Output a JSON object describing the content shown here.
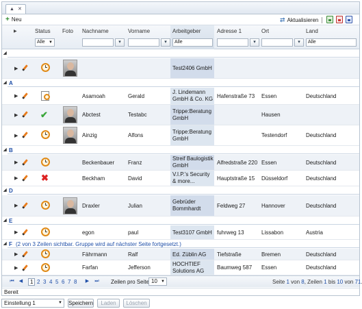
{
  "toolbar": {
    "new_label": "Neu",
    "refresh_label": "Aktualisieren"
  },
  "columns": {
    "status": "Status",
    "photo": "Foto",
    "lastname": "Nachname",
    "firstname": "Vorname",
    "employer": "Arbeitgeber",
    "address": "Adresse 1",
    "city": "Ort",
    "country": "Land"
  },
  "filters": {
    "status": "Alle",
    "employer": "Alle",
    "country": "Alle"
  },
  "groups": {
    "blank": "",
    "A": "A",
    "B": "B",
    "D": "D",
    "E": "E",
    "F": "F",
    "F_note": "(2 von 3 Zeilen sichtbar. Gruppe wird auf nächster Seite fortgesetzt.)"
  },
  "rows": [
    {
      "status": "clock",
      "lastname": "",
      "firstname": "",
      "employer": "Test2406 GmbH",
      "address": "",
      "city": "",
      "country": ""
    },
    {
      "status": "doc-clock",
      "lastname": "Asamoah",
      "firstname": "Gerald",
      "employer": "J. Lindemann GmbH & Co. KG",
      "address": "Hafenstraße 73",
      "city": "Essen",
      "country": "Deutschland"
    },
    {
      "status": "check",
      "lastname": "Abctest",
      "firstname": "Testabc",
      "employer": "Trippe:Beratung GmbH",
      "address": "",
      "city": "Hausen",
      "country": ""
    },
    {
      "status": "clock",
      "lastname": "Ainzig",
      "firstname": "Alfons",
      "employer": "Trippe:Beratung GmbH",
      "address": "",
      "city": "Testendorf",
      "country": "Deutschland"
    },
    {
      "status": "clock",
      "lastname": "Beckenbauer",
      "firstname": "Franz",
      "employer": "Streif Baulogistik GmbH",
      "address": "Alfredstraße 220",
      "city": "Essen",
      "country": "Deutschland"
    },
    {
      "status": "cross",
      "lastname": "Beckham",
      "firstname": "David",
      "employer": "V.I.P.'s Security & more...",
      "address": "Hauptstraße 15",
      "city": "Düsseldorf",
      "country": "Deutschland"
    },
    {
      "status": "clock",
      "lastname": "Draxler",
      "firstname": "Julian",
      "employer": "Gebrüder Bommhardt",
      "address": "Feldweg 27",
      "city": "Hannover",
      "country": "Deutschland"
    },
    {
      "status": "clock",
      "lastname": "egon",
      "firstname": "paul",
      "employer": "Test3107 GmbH",
      "address": "fuhrweg 13",
      "city": "Lissabon",
      "country": "Austria"
    },
    {
      "status": "clock",
      "lastname": "Fährmann",
      "firstname": "Ralf",
      "employer": "Ed. Züblin AG",
      "address": "Tiefstraße",
      "city": "Bremen",
      "country": "Deutschland"
    },
    {
      "status": "clock",
      "lastname": "Farfan",
      "firstname": "Jefferson",
      "employer": "HOCHTIEF Solutions AG",
      "address": "Baumweg 587",
      "city": "Essen",
      "country": "Deutschland"
    }
  ],
  "pager": {
    "pages": [
      "1",
      "2",
      "3",
      "4",
      "5",
      "6",
      "7",
      "8"
    ],
    "current_page": "1",
    "page_size_label": "Zeilen pro Seite:",
    "page_size": "10",
    "info_prefix": "Seite ",
    "info_page": "1",
    "info_of": " von ",
    "info_pages": "8",
    "info_rows": ", Zeilen ",
    "info_from": "1",
    "info_to_word": " bis ",
    "info_to": "10",
    "info_of2": " von ",
    "info_total": "71",
    "info_end": "."
  },
  "status_text": "Bereit",
  "bottom": {
    "setting": "Einstellung 1",
    "save": "Speichern",
    "load": "Laden",
    "delete": "Löschen"
  },
  "colors": {
    "accent": "#1f4fa8",
    "clock": "#e08a17",
    "check": "#3aa63a",
    "cross": "#dd2222"
  }
}
